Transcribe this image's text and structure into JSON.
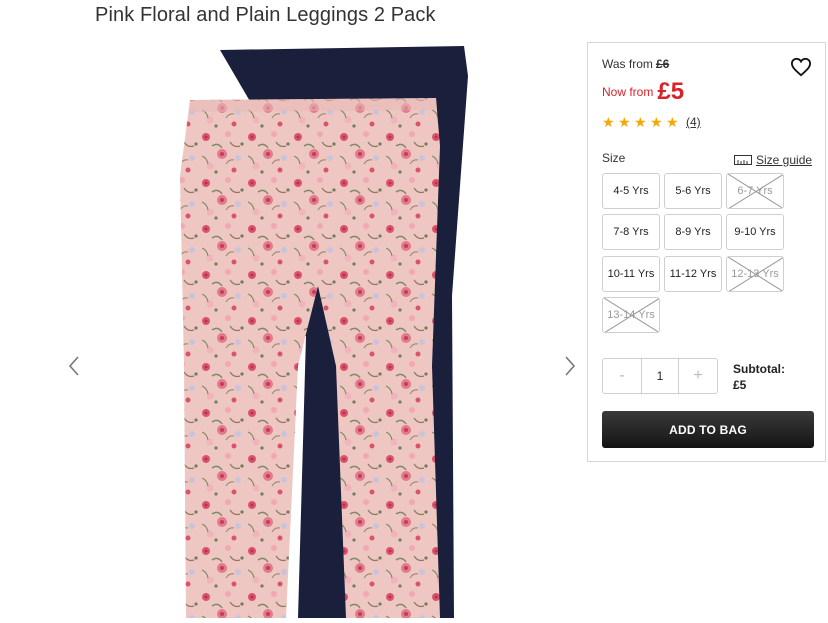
{
  "product": {
    "title": "Pink Floral and Plain Leggings 2 Pack"
  },
  "gallery": {
    "image_alt": "Pink floral leggings in front of navy plain leggings",
    "prev_icon": "chevron-left-icon",
    "next_icon": "chevron-right-icon",
    "colors": {
      "navy": "#1a1f3c",
      "pink": "#eec7c2"
    }
  },
  "pricing": {
    "was_label": "Was from",
    "was_price": "£6",
    "now_label": "Now from",
    "now_price": "£5",
    "sale_color": "#d8232a"
  },
  "wishlist": {
    "icon": "heart-icon"
  },
  "rating": {
    "stars": 5,
    "max": 5,
    "reviews": "(4)",
    "star_color": "#f5a800"
  },
  "size": {
    "label": "Size",
    "guide_label": "Size guide",
    "guide_icon": "ruler-icon",
    "options": [
      {
        "label": "4-5 Yrs",
        "available": true
      },
      {
        "label": "5-6 Yrs",
        "available": true
      },
      {
        "label": "6-7 Yrs",
        "available": false
      },
      {
        "label": "7-8 Yrs",
        "available": true
      },
      {
        "label": "8-9 Yrs",
        "available": true
      },
      {
        "label": "9-10 Yrs",
        "available": true
      },
      {
        "label": "10-11 Yrs",
        "available": true
      },
      {
        "label": "11-12 Yrs",
        "available": true
      },
      {
        "label": "12-13 Yrs",
        "available": false
      },
      {
        "label": "13-14 Yrs",
        "available": false
      }
    ]
  },
  "quantity": {
    "decrement": "-",
    "value": "1",
    "increment": "+"
  },
  "subtotal": {
    "label": "Subtotal:",
    "value": "£5"
  },
  "cart": {
    "add_label": "ADD TO BAG"
  }
}
